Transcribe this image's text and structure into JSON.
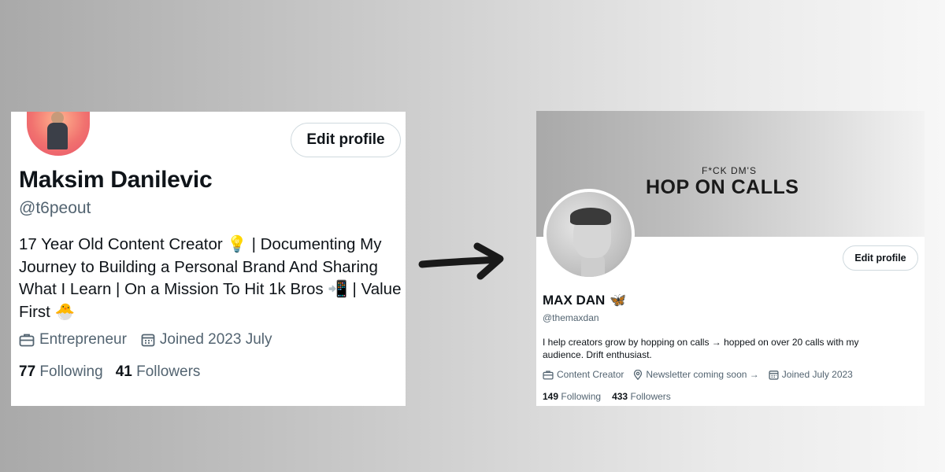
{
  "left_profile": {
    "edit_button": "Edit profile",
    "name": "Maksim Danilevic",
    "handle": "@t6peout",
    "bio": "17 Year Old Content Creator 💡 | Documenting My Journey to Building a Personal Brand And Sharing What I Learn | On a Mission To Hit 1k Bros 📲 | Value First 🐣",
    "category": "Entrepreneur",
    "joined": "Joined 2023 July",
    "following_count": "77",
    "following_label": "Following",
    "followers_count": "41",
    "followers_label": "Followers"
  },
  "right_profile": {
    "banner_small": "F*CK DM'S",
    "banner_big": "HOP ON CALLS",
    "edit_button": "Edit profile",
    "name": "MAX DAN",
    "name_emoji": "🦋",
    "handle": "@themaxdan",
    "bio": "I help creators grow by hopping on calls → hopped on over 20 calls with my audience. Drift enthusiast.",
    "category": "Content Creator",
    "location": "Newsletter coming soon →",
    "joined": "Joined July 2023",
    "following_count": "149",
    "following_label": "Following",
    "followers_count": "433",
    "followers_label": "Followers"
  },
  "icons": [
    "briefcase-icon",
    "calendar-icon",
    "location-pin-icon",
    "arrow-icon"
  ],
  "colors": {
    "text": "#0f1419",
    "muted": "#536471",
    "border": "#cfd9de"
  }
}
